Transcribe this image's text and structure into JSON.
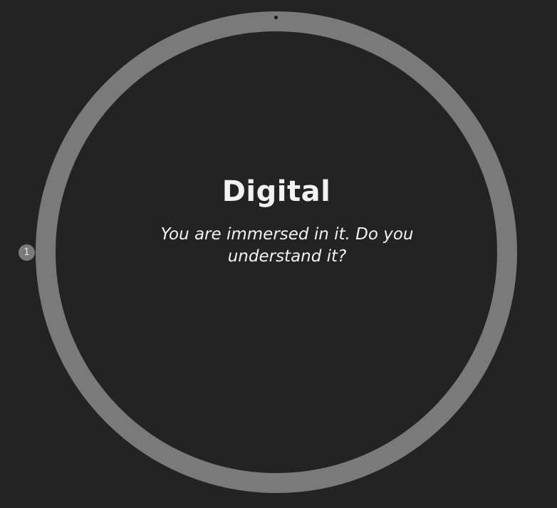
{
  "slide": {
    "title": "Digital",
    "subtitle": "You are immersed in it. Do you understand it?"
  },
  "navigation": {
    "step_number": "1"
  },
  "colors": {
    "background": "#232323",
    "ring": "#7a7a7a",
    "text": "#f2f2f2"
  }
}
